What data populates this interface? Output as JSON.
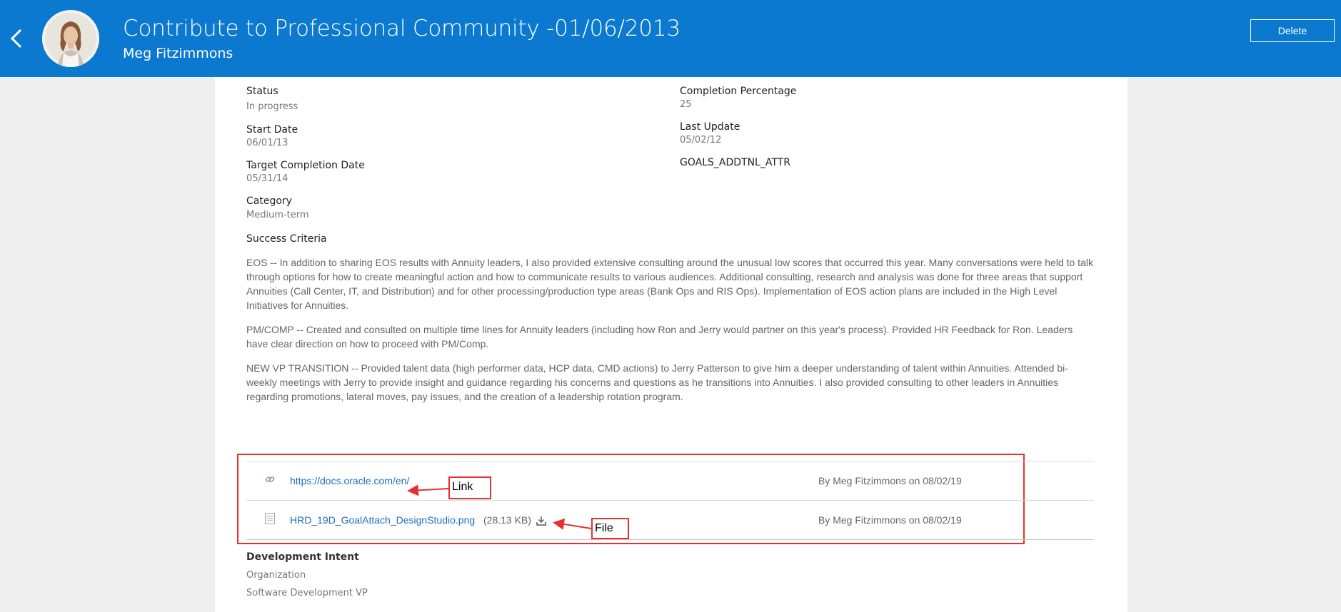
{
  "header": {
    "title": "Contribute to Professional Community -01/06/2013",
    "subtitle": "Meg Fitzimmons",
    "delete_label": "Delete",
    "background": "#0b79d0"
  },
  "fields": {
    "status": {
      "label": "Status",
      "value": "In progress"
    },
    "completion_percentage": {
      "label": "Completion Percentage",
      "value": "25"
    },
    "start_date": {
      "label": "Start Date",
      "value": "06/01/13"
    },
    "last_update": {
      "label": "Last Update",
      "value": "05/02/12"
    },
    "target_completion_date": {
      "label": "Target Completion Date",
      "value": "05/31/14"
    },
    "goals_addtnl_attr": {
      "label": "GOALS_ADDTNL_ATTR"
    },
    "category": {
      "label": "Category",
      "value": "Medium-term"
    },
    "success_criteria": {
      "label": "Success Criteria"
    }
  },
  "success_criteria_paragraphs": [
    "EOS  -- In addition to sharing EOS results with Annuity leaders, I also provided extensive consulting around the unusual low scores that occurred this year.  Many conversations were held to talk through options for how to create meaningful action and how to communicate results to various audiences.  Additional consulting, research and analysis was done for three areas that support Annuities (Call Center, IT, and Distribution) and for other processing/production type areas (Bank Ops and RIS Ops).  Implementation of EOS action plans are included in the High Level Initiatives for Annuities.",
    "PM/COMP  --  Created and consulted on multiple time lines for Annuity leaders (including how Ron and Jerry would partner on this year's process).   Provided HR Feedback for Ron.  Leaders have clear direction on how to proceed with PM/Comp.",
    "NEW VP TRANSITION -- Provided talent data (high performer data, HCP data, CMD actions) to Jerry Patterson to give him a deeper understanding of talent within Annuities.  Attended bi-weekly meetings with Jerry to provide insight and guidance regarding his concerns and questions as he transitions into Annuities.  I also provided consulting to other leaders in Annuities regarding promotions, lateral moves, pay issues, and the creation of a leadership rotation program."
  ],
  "attachments": [
    {
      "icon": "link-icon",
      "name": "https://docs.oracle.com/en/",
      "meta": "By Meg Fitzimmons on 08/02/19"
    },
    {
      "icon": "document-icon",
      "name": "HRD_19D_GoalAttach_DesignStudio.png",
      "size": "(28.13 KB)",
      "meta": "By Meg Fitzimmons on 08/02/19"
    }
  ],
  "annotations": {
    "link_label": "Link",
    "file_label": "File",
    "color": "#e4312f"
  },
  "development_intent": {
    "title": "Development Intent",
    "lines": [
      "Organization",
      "Software Development VP"
    ]
  }
}
